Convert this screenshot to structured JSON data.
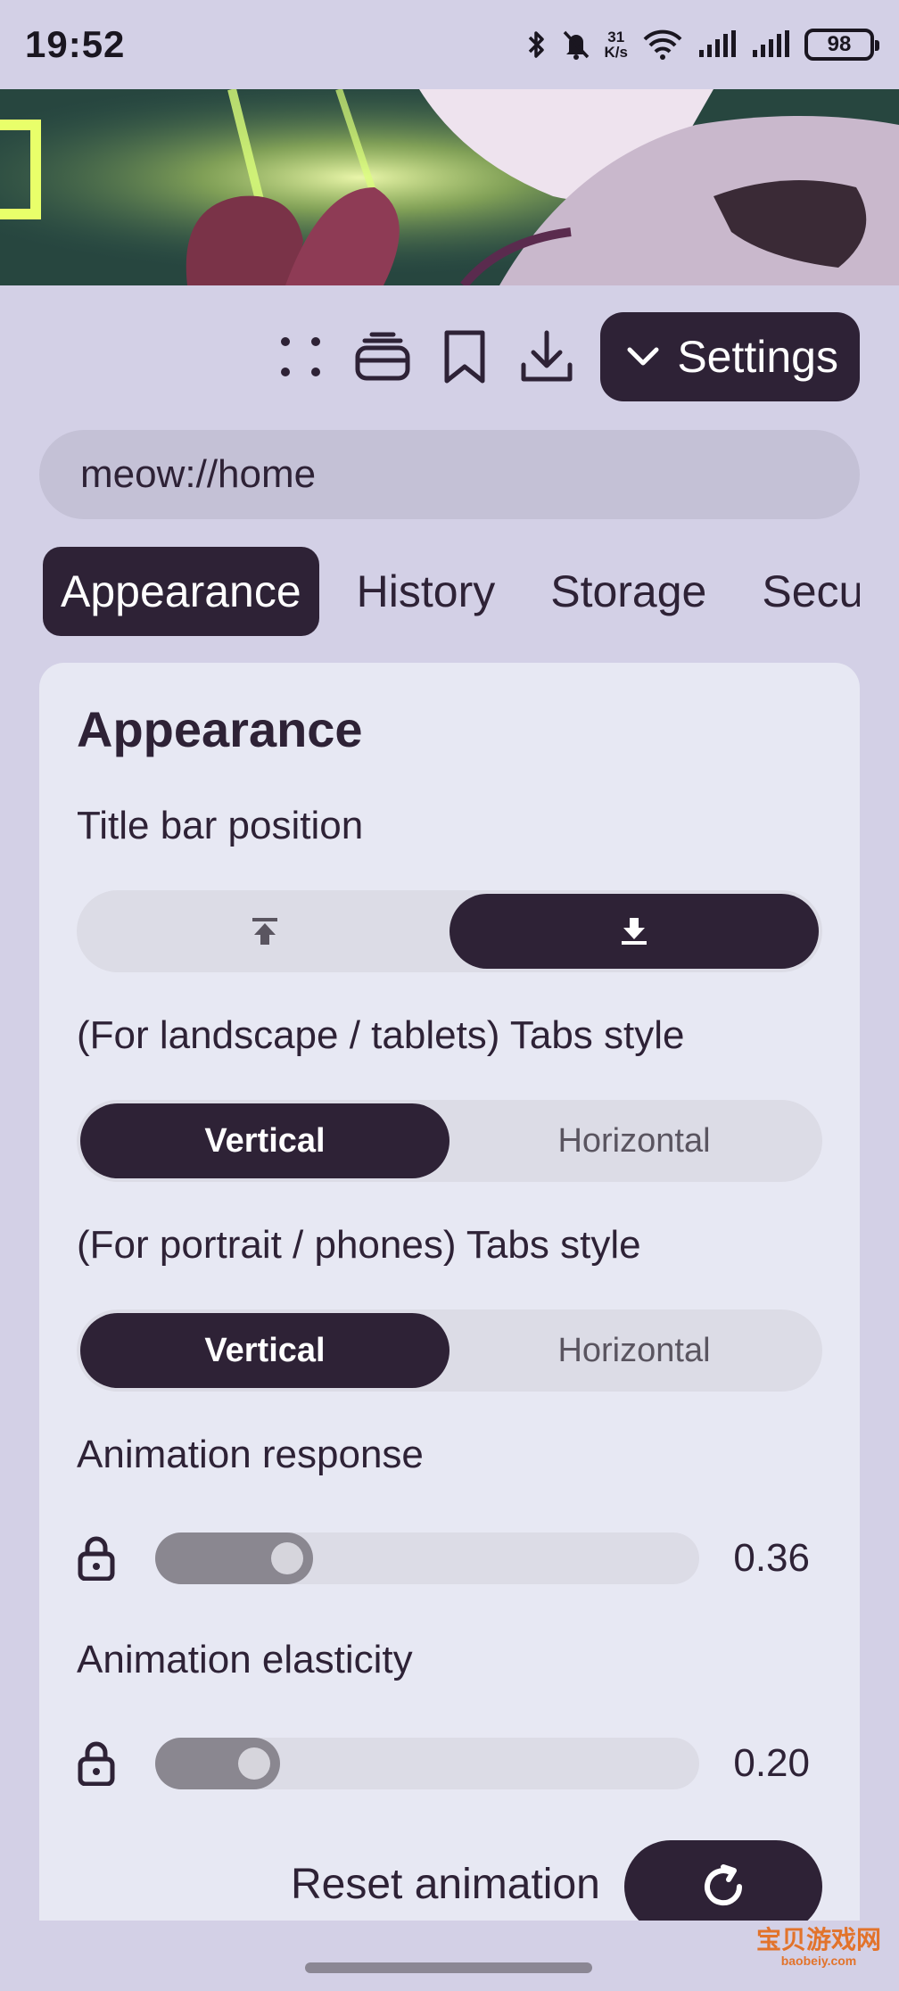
{
  "status_bar": {
    "time": "19:52",
    "net_speed_value": "31",
    "net_speed_unit": "K/s",
    "battery": "98",
    "icons": [
      "bluetooth-icon",
      "mute-icon",
      "wifi-icon",
      "signal-icon",
      "signal-icon",
      "battery-icon"
    ]
  },
  "toolbar": {
    "icons": [
      "drag-handle-icon",
      "tabs-stack-icon",
      "bookmark-icon",
      "download-icon"
    ],
    "settings_label": "Settings"
  },
  "url_bar": {
    "value": "meow://home"
  },
  "tabs": [
    "Appearance",
    "History",
    "Storage",
    "Security"
  ],
  "active_tab": 0,
  "card": {
    "title": "Appearance",
    "title_bar_position": {
      "label": "Title bar position",
      "options": [
        "align-top-icon",
        "align-bottom-icon"
      ],
      "selected": 1
    },
    "landscape_tabs_style": {
      "label": "(For landscape / tablets) Tabs style",
      "options": [
        "Vertical",
        "Horizontal"
      ],
      "selected": 0
    },
    "portrait_tabs_style": {
      "label": "(For portrait / phones) Tabs style",
      "options": [
        "Vertical",
        "Horizontal"
      ],
      "selected": 0
    },
    "animation_response": {
      "label": "Animation response",
      "value": "0.36",
      "fill_fraction": 0.29
    },
    "animation_elasticity": {
      "label": "Animation elasticity",
      "value": "0.20",
      "fill_fraction": 0.23
    },
    "reset_label": "Reset animation"
  },
  "watermark": {
    "text": "宝贝游戏网",
    "sub": "baobeiy.com"
  },
  "colors": {
    "accent": "#2e2236",
    "background": "#d3d0e6",
    "card": "#e7e8f3"
  }
}
